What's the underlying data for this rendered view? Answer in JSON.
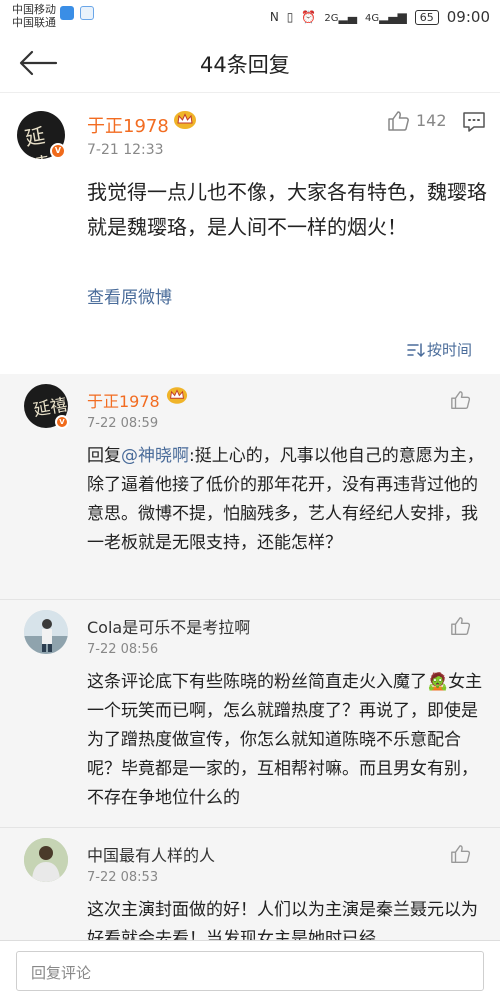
{
  "status_bar": {
    "carrier1": "中国移动",
    "carrier2": "中国联通",
    "battery": "65",
    "time": "09:00",
    "signal1": "2G",
    "signal2": "4G"
  },
  "header": {
    "title": "44条回复"
  },
  "main_post": {
    "author": "于正1978",
    "time": "7-21 12:33",
    "likes": "142",
    "text": "我觉得一点儿也不像，大家各有特色，魏璎珞就是魏璎珞，是人间不一样的烟火！",
    "view_original": "查看原微博"
  },
  "sort_label": "按时间",
  "replies": [
    {
      "author": "于正1978",
      "time": "7-22 08:59",
      "prefix": "回复",
      "mention": "@神晓啊",
      "text": ":挺上心的，凡事以他自己的意愿为主，除了逼着他接了低价的那年花开，没有再违背过他的意思。微博不提，怕脑残多，艺人有经纪人安排，我一老板就是无限支持，还能怎样？"
    },
    {
      "author": "Cola是可乐不是考拉啊",
      "time": "7-22 08:56",
      "text": "这条评论底下有些陈晓的粉丝简直走火入魔了🧟女主一个玩笑而已啊，怎么就蹭热度了？再说了，即使是为了蹭热度做宣传，你怎么就知道陈晓不乐意配合呢？毕竟都是一家的，互相帮衬嘛。而且男女有别，不存在争地位什么的"
    },
    {
      "author": "中国最有人样的人",
      "time": "7-22 08:53",
      "text": "这次主演封面做的好！人们以为主演是秦兰聂元以为好看就会去看！当发现女主是她时已经"
    }
  ],
  "reply_input": {
    "placeholder": "回复评论"
  },
  "colors": {
    "accent_orange": "#f26c21",
    "link_blue": "#4a6c9a",
    "vip_gold": "#f0b429"
  }
}
